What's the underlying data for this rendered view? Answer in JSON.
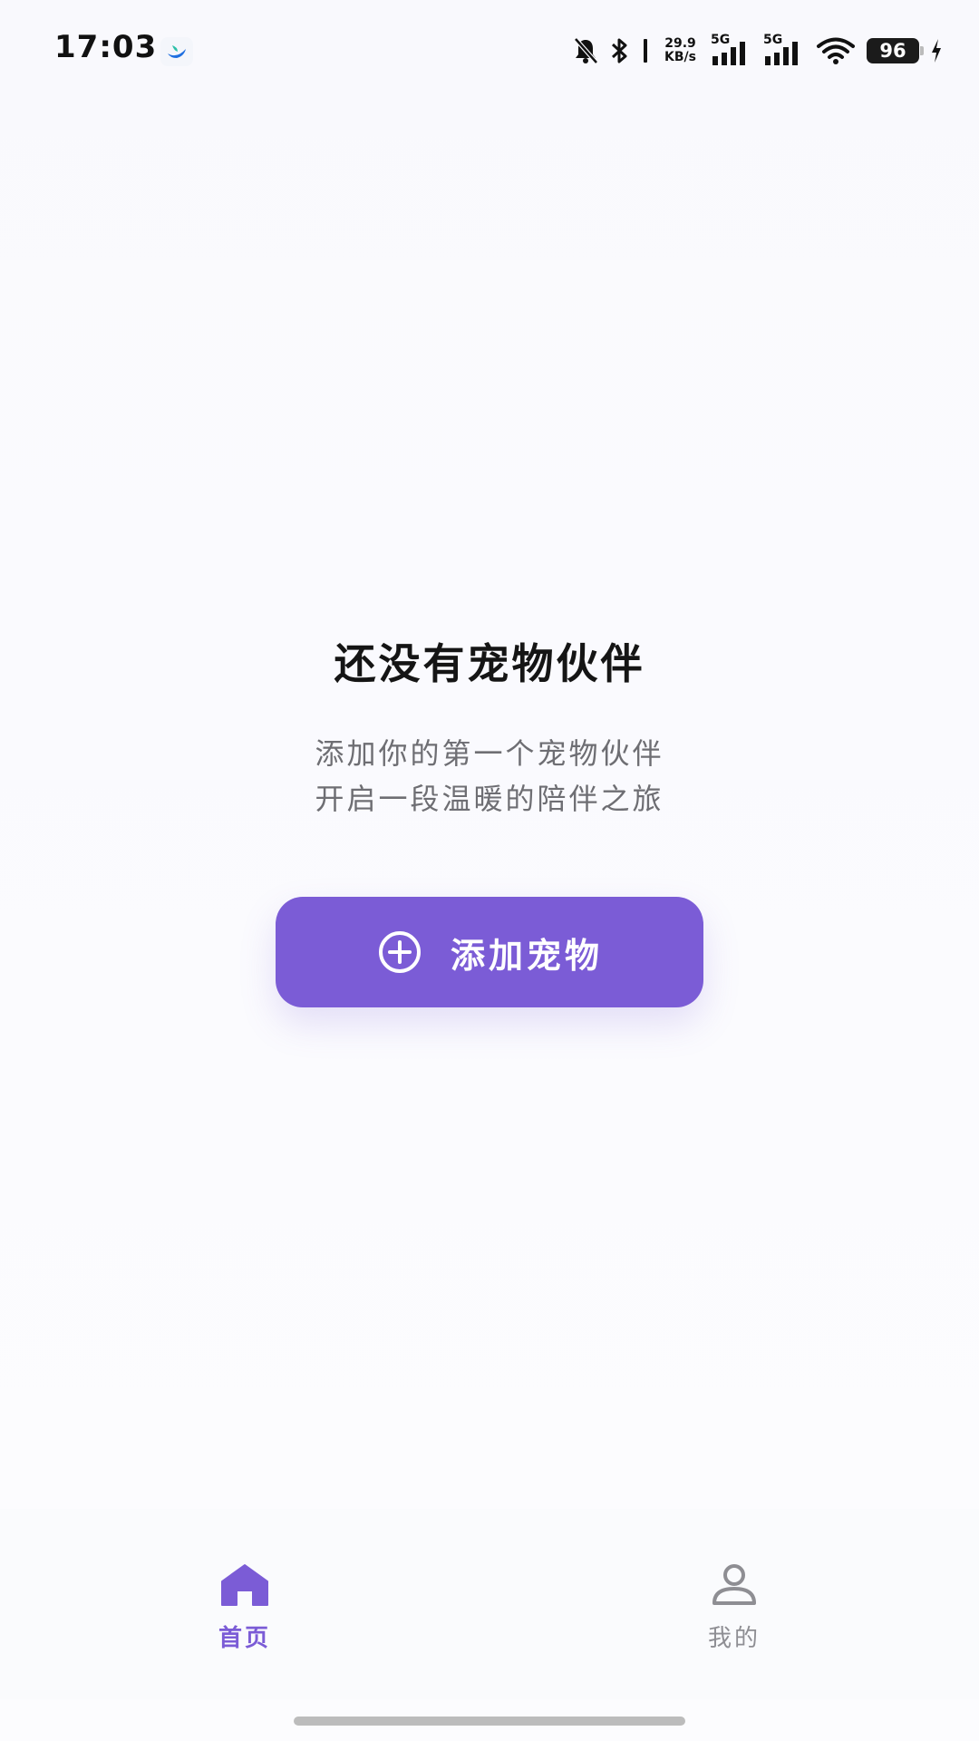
{
  "status_bar": {
    "time": "17:03",
    "net_speed_value": "29.9",
    "net_speed_unit": "KB/s",
    "signal_1_label": "5G",
    "signal_2_label": "5G",
    "battery_level": "96",
    "icons": [
      "app-notification-icon",
      "mute-bell-icon",
      "bluetooth-icon",
      "signal-icon",
      "signal-icon",
      "wifi-icon",
      "battery-icon",
      "charging-icon"
    ]
  },
  "empty_state": {
    "title": "还没有宠物伙伴",
    "description_line1": "添加你的第一个宠物伙伴",
    "description_line2": "开启一段温暖的陪伴之旅",
    "button_label": "添加宠物",
    "button_icon": "plus-circle-icon"
  },
  "bottom_nav": {
    "items": [
      {
        "label": "首页",
        "icon": "home-icon",
        "active": true
      },
      {
        "label": "我的",
        "icon": "user-icon",
        "active": false
      }
    ]
  },
  "colors": {
    "accent": "#7b5cd6",
    "background": "#f9f9fd",
    "title_text": "#151515",
    "secondary_text": "#6e6e73",
    "inactive_nav": "#8e8e93"
  }
}
